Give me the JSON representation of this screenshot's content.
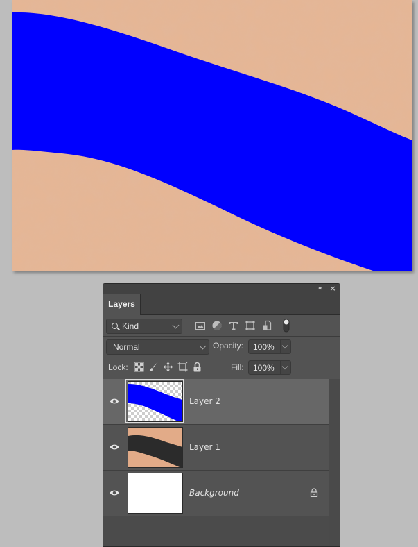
{
  "canvas": {
    "description": "Photo of skin with a blue diagonal stroke painted on Layer 2",
    "skin_color": "#e7b896",
    "stroke_color": "#0000ff"
  },
  "panel": {
    "collapse_icon": "double-chevron-left-icon",
    "close_icon": "close-icon",
    "tab_label": "Layers",
    "menu_icon": "hamburger-menu-icon",
    "filter": {
      "kind_label": "Kind",
      "icons": [
        "pixel-layer-filter-icon",
        "adjustment-layer-filter-icon",
        "type-layer-filter-icon",
        "shape-layer-filter-icon",
        "smart-object-filter-icon",
        "filter-toggle-icon"
      ]
    },
    "blend_mode": "Normal",
    "opacity_label": "Opacity:",
    "opacity_value": "100%",
    "lock_label": "Lock:",
    "lock_icons": [
      "lock-transparent-pixels-icon",
      "lock-image-pixels-icon",
      "lock-position-icon",
      "lock-artboard-icon",
      "lock-all-icon"
    ],
    "fill_label": "Fill:",
    "fill_value": "100%",
    "layers": [
      {
        "name": "Layer 2",
        "visible": true,
        "selected": true,
        "italic": false,
        "locked": false
      },
      {
        "name": "Layer 1",
        "visible": true,
        "selected": false,
        "italic": false,
        "locked": false
      },
      {
        "name": "Background",
        "visible": true,
        "selected": false,
        "italic": true,
        "locked": true
      }
    ]
  }
}
